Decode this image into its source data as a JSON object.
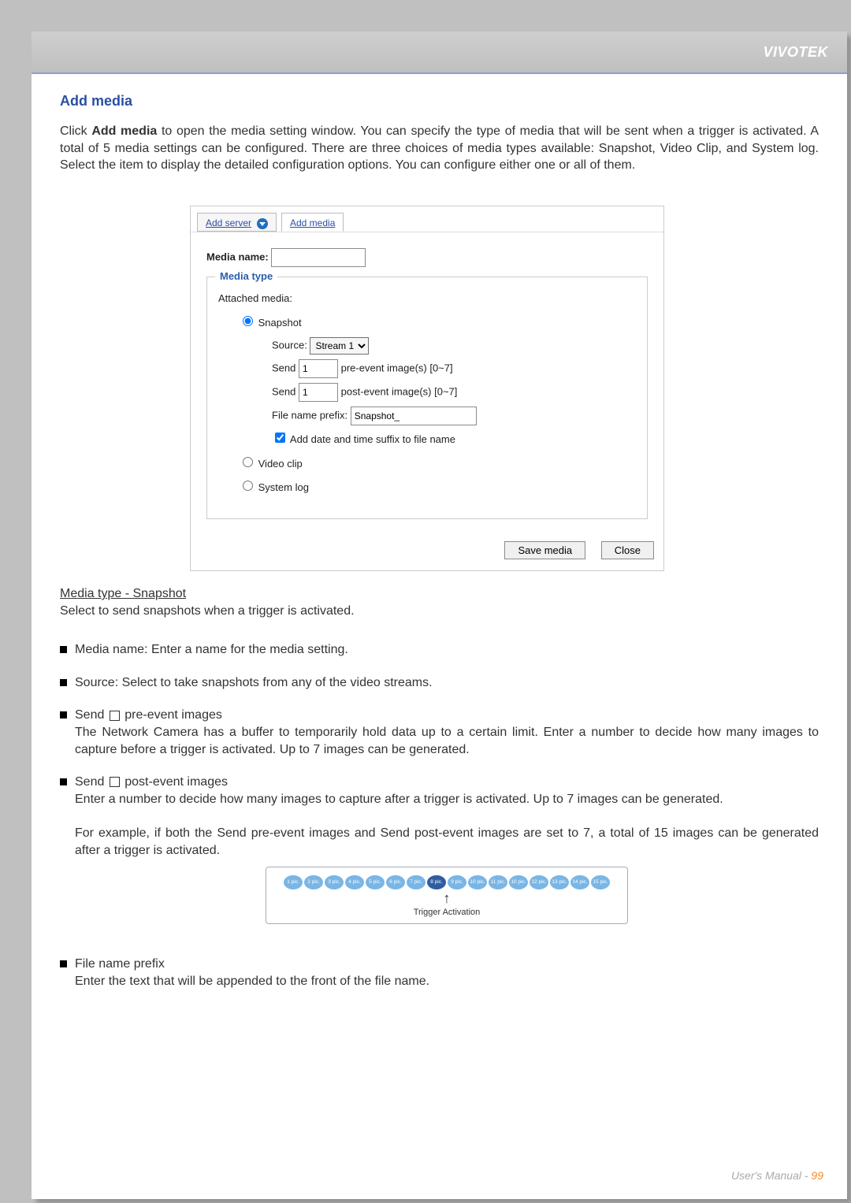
{
  "header": {
    "brand": "VIVOTEK"
  },
  "section": {
    "title": "Add media",
    "intro_prefix": "Click ",
    "intro_bold": "Add media",
    "intro_suffix": " to open the media setting window. You can specify the type of media that will be sent when a trigger is activated. A total of 5 media settings can be configured. There are three choices of media types available: Snapshot, Video Clip, and System log. Select the item to display the detailed configuration options. You can configure either one or all of them."
  },
  "window": {
    "add_server": "Add server",
    "add_media": "Add media",
    "media_name_label": "Media name:",
    "media_name_value": "",
    "fieldset_title": "Media type",
    "attached_media_label": "Attached media:",
    "opt_snapshot": "Snapshot",
    "source_label": "Source:",
    "source_value": "Stream 1",
    "send_label": "Send",
    "pre_value": "1",
    "pre_suffix": "pre-event image(s) [0~7]",
    "post_value": "1",
    "post_suffix": "post-event image(s) [0~7]",
    "prefix_label": "File name prefix:",
    "prefix_value": "Snapshot_",
    "add_datetime_label": "Add date and time suffix to file name",
    "opt_video": "Video clip",
    "opt_syslog": "System log",
    "save_btn": "Save media",
    "close_btn": "Close"
  },
  "sub": {
    "heading": "Media type - Snapshot",
    "heading_sub": "Select to send snapshots when a trigger is activated."
  },
  "bullets": {
    "media_name": "Media name: Enter a name for the media setting.",
    "source": "Source: Select to take snapshots from any of the video streams.",
    "pre_head_a": "Send ",
    "pre_head_b": " pre-event images",
    "pre_body": "The Network Camera has a buffer to temporarily hold data up to a certain limit. Enter a number to decide how many images to capture before a trigger is activated. Up to 7 images can be generated.",
    "post_head_a": "Send ",
    "post_head_b": " post-event images",
    "post_body1": "Enter a number to decide how many images to capture after a trigger is activated. Up to 7 images can be generated.",
    "post_body2": "For example, if both the Send pre-event images and Send post-event images are set to 7, a total of 15 images can be generated after a trigger is activated.",
    "fname_head": "File name prefix",
    "fname_body": "Enter the text that will be appended to the front of the file name."
  },
  "diagram": {
    "pics": [
      "1 pic.",
      "2 pic.",
      "3 pic.",
      "4 pic.",
      "5 pic.",
      "6 pic.",
      "7 pic.",
      "8 pic.",
      "9 pic.",
      "10 pic.",
      "11 pic.",
      "10 pic.",
      "12 pic.",
      "13 pic.",
      "14 pic.",
      "15 pic."
    ],
    "highlight_index": 7,
    "label": "Trigger Activation"
  },
  "footer": {
    "text": "User's Manual - ",
    "page": "99"
  }
}
